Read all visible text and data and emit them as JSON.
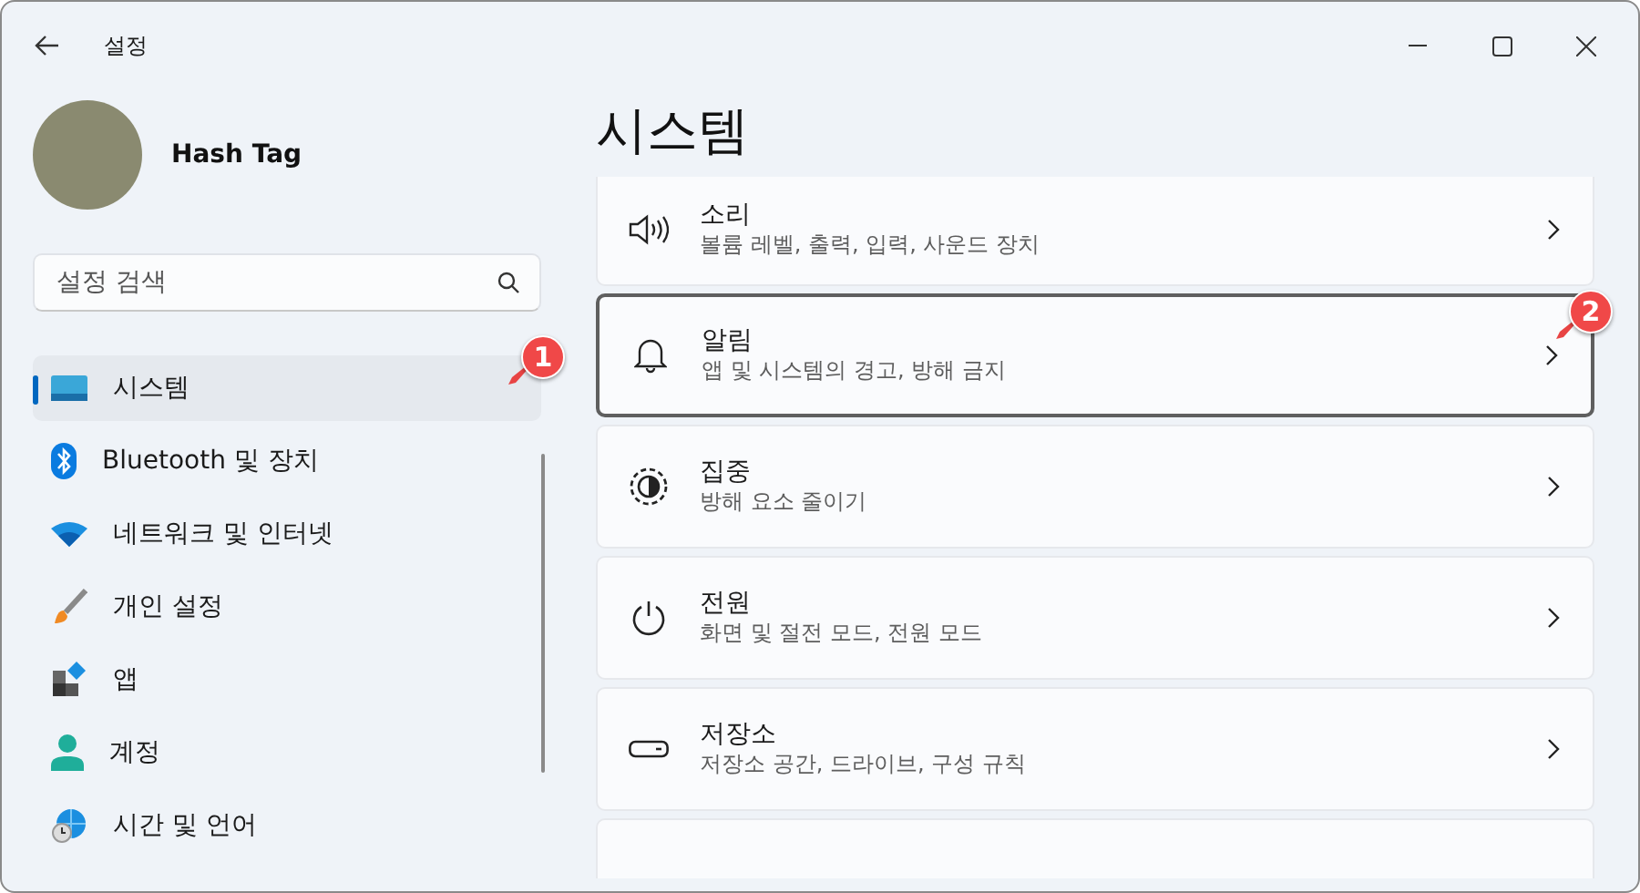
{
  "window": {
    "title": "설정"
  },
  "user": {
    "name": "Hash Tag"
  },
  "search": {
    "placeholder": "설정 검색"
  },
  "sidebar": {
    "items": [
      {
        "label": "시스템",
        "selected": true
      },
      {
        "label": "Bluetooth 및 장치",
        "selected": false
      },
      {
        "label": "네트워크 및 인터넷",
        "selected": false
      },
      {
        "label": "개인 설정",
        "selected": false
      },
      {
        "label": "앱",
        "selected": false
      },
      {
        "label": "계정",
        "selected": false
      },
      {
        "label": "시간 및 언어",
        "selected": false
      }
    ]
  },
  "page": {
    "title": "시스템",
    "cards": [
      {
        "title": "소리",
        "subtitle": "볼륨 레벨, 출력, 입력, 사운드 장치",
        "selected": false
      },
      {
        "title": "알림",
        "subtitle": "앱 및 시스템의 경고, 방해 금지",
        "selected": true
      },
      {
        "title": "집중",
        "subtitle": "방해 요소 줄이기",
        "selected": false
      },
      {
        "title": "전원",
        "subtitle": "화면 및 절전 모드, 전원 모드",
        "selected": false
      },
      {
        "title": "저장소",
        "subtitle": "저장소 공간, 드라이브, 구성 규칙",
        "selected": false
      },
      {
        "selected": false
      }
    ]
  },
  "annotations": [
    {
      "label": "1"
    },
    {
      "label": "2"
    }
  ]
}
